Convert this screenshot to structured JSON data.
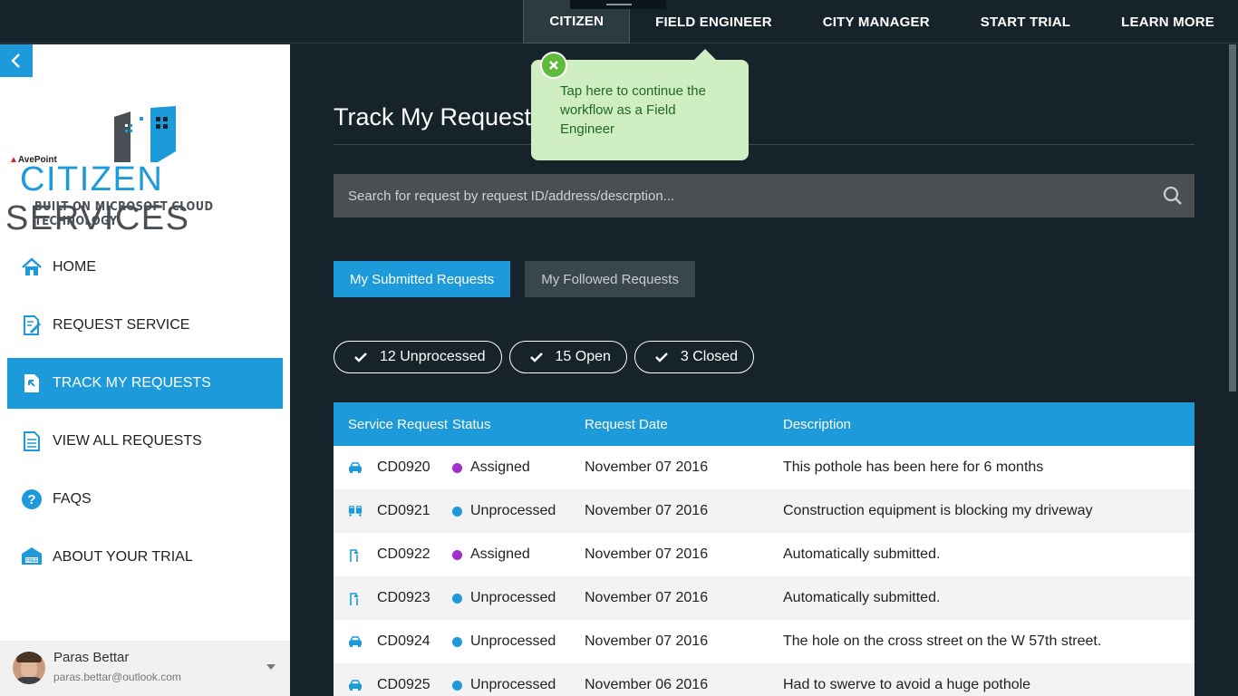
{
  "topnav": {
    "items": [
      {
        "label": "CITIZEN"
      },
      {
        "label": "FIELD ENGINEER"
      },
      {
        "label": "CITY MANAGER"
      },
      {
        "label": "START TRIAL"
      },
      {
        "label": "LEARN MORE"
      }
    ]
  },
  "tooltip": {
    "text": "Tap here to continue the workflow as a Field Engineer"
  },
  "logo": {
    "brand": "AvePoint",
    "name_part1": "CITIZEN",
    "name_part2": "SERVICES",
    "tagline": "BUILT ON MICROSOFT CLOUD TECHNOLOGY"
  },
  "sidebar": {
    "items": [
      {
        "label": "HOME",
        "icon": "home-icon"
      },
      {
        "label": "REQUEST SERVICE",
        "icon": "edit-document-icon"
      },
      {
        "label": "TRACK MY REQUESTS",
        "icon": "track-document-icon"
      },
      {
        "label": "VIEW ALL REQUESTS",
        "icon": "list-document-icon"
      },
      {
        "label": "FAQS",
        "icon": "question-icon"
      },
      {
        "label": "ABOUT YOUR TRIAL",
        "icon": "free-badge-icon"
      }
    ]
  },
  "user": {
    "name": "Paras Bettar",
    "email": "paras.bettar@outlook.com"
  },
  "main": {
    "title": "Track My Requests",
    "search_placeholder": "Search for request by request ID/address/descrption...",
    "tabs": [
      {
        "label": "My Submitted Requests"
      },
      {
        "label": "My Followed Requests"
      }
    ],
    "filters": [
      {
        "label": "12 Unprocessed"
      },
      {
        "label": "15 Open"
      },
      {
        "label": "3 Closed"
      }
    ],
    "table": {
      "headers": [
        "Service Request",
        "Status",
        "Request Date",
        "Description"
      ],
      "rows": [
        {
          "icon": "car-icon",
          "id": "CD0920",
          "status": "Assigned",
          "status_color": "#a22fc9",
          "date": "November 07 2016",
          "description": "This pothole has been here for 6 months"
        },
        {
          "icon": "vehicles-icon",
          "id": "CD0921",
          "status": "Unprocessed",
          "status_color": "#1d9ad9",
          "date": "November 07 2016",
          "description": "Construction equipment is blocking my driveway"
        },
        {
          "icon": "streetlight-icon",
          "id": "CD0922",
          "status": "Assigned",
          "status_color": "#a22fc9",
          "date": "November 07 2016",
          "description": "Automatically submitted."
        },
        {
          "icon": "streetlight-icon",
          "id": "CD0923",
          "status": "Unprocessed",
          "status_color": "#1d9ad9",
          "date": "November 07 2016",
          "description": "Automatically submitted."
        },
        {
          "icon": "car-icon",
          "id": "CD0924",
          "status": "Unprocessed",
          "status_color": "#1d9ad9",
          "date": "November 07 2016",
          "description": "The hole on the cross street on the W 57th street."
        },
        {
          "icon": "car-icon",
          "id": "CD0925",
          "status": "Unprocessed",
          "status_color": "#1d9ad9",
          "date": "November 06 2016",
          "description": "Had to swerve to avoid a huge pothole"
        }
      ]
    }
  },
  "colors": {
    "accent": "#1d9ad9",
    "background": "#16232a",
    "tooltip_bg": "#cfeec2",
    "assigned": "#a22fc9",
    "unprocessed": "#1d9ad9"
  }
}
